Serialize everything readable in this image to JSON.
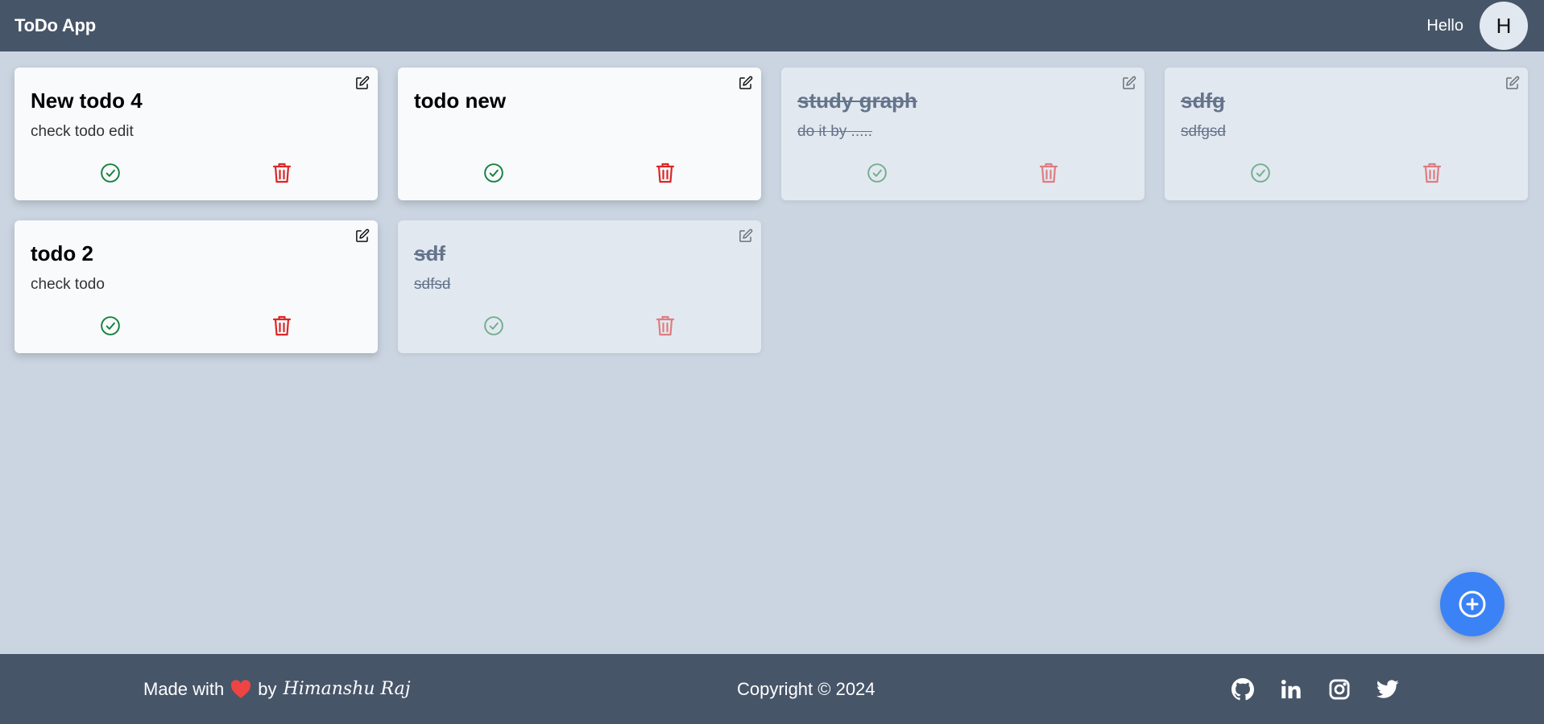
{
  "navbar": {
    "brand": "ToDo App",
    "greeting": "Hello",
    "avatar_initial": "H"
  },
  "todos": [
    {
      "title": "New todo 4",
      "desc": "check todo edit",
      "completed": false
    },
    {
      "title": "todo new",
      "desc": "",
      "completed": false
    },
    {
      "title": "study graph",
      "desc": "do it by .....",
      "completed": true
    },
    {
      "title": "sdfg",
      "desc": "sdfgsd",
      "completed": true
    },
    {
      "title": "todo 2",
      "desc": "check todo",
      "completed": false
    },
    {
      "title": "sdf",
      "desc": "sdfsd",
      "completed": true
    }
  ],
  "icons": {
    "edit": "edit-icon",
    "complete": "check-circle-icon",
    "delete": "trash-icon",
    "add": "plus-circle-icon",
    "heart": "heart-icon",
    "socials": [
      "github-icon",
      "linkedin-icon",
      "instagram-icon",
      "twitter-icon"
    ]
  },
  "footer": {
    "made_with": "Made with",
    "by": "by",
    "author": "Himanshu Raj",
    "copyright": "Copyright © 2024"
  },
  "colors": {
    "header_bg": "#475569",
    "page_bg": "#cbd5e1",
    "complete": "#15803d",
    "delete": "#dc2626",
    "heart": "#ef4444",
    "fab": "#3b82f6"
  }
}
